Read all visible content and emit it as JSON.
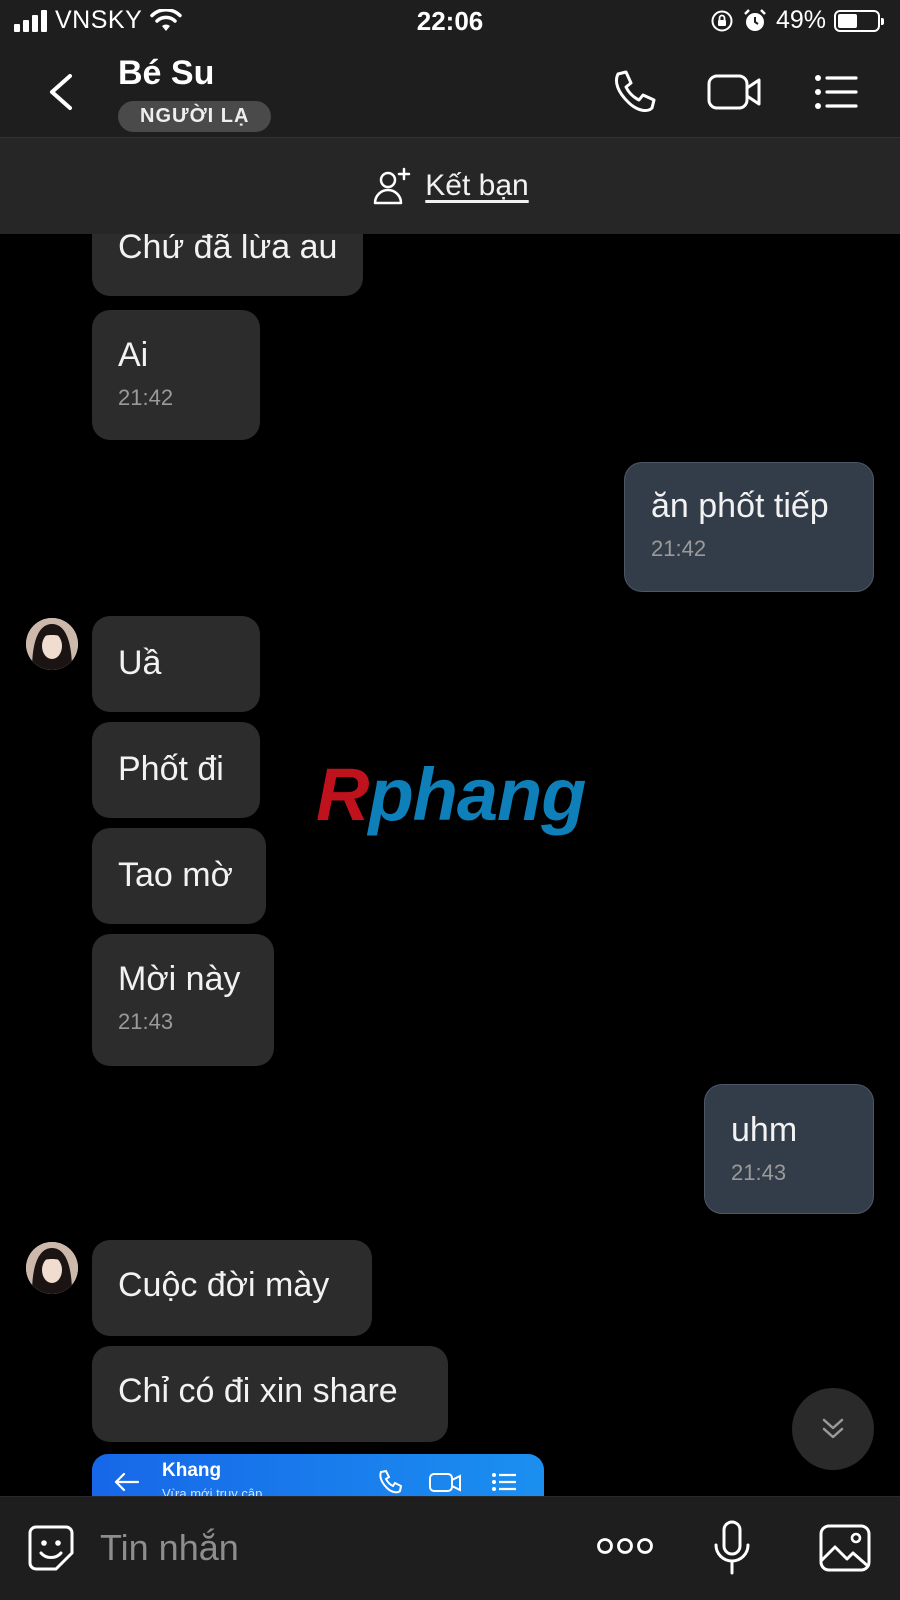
{
  "status_bar": {
    "carrier": "VNSKY",
    "time": "22:06",
    "battery_percent": "49%",
    "battery_level": 0.49
  },
  "header": {
    "contact_name": "Bé Su",
    "badge": "NGƯỜI LẠ",
    "icons": [
      "back-icon",
      "phone-icon",
      "video-camera-icon",
      "list-menu-icon"
    ]
  },
  "friend_bar": {
    "label": "Kết bạn",
    "icon": "add-user-icon"
  },
  "messages": [
    {
      "direction": "in",
      "text": "Chứ đã lừa au"
    },
    {
      "direction": "in",
      "text": "Ai",
      "time": "21:42"
    },
    {
      "direction": "out",
      "text": "ăn phốt tiếp",
      "time": "21:42"
    },
    {
      "direction": "in",
      "text": "Uầ",
      "avatar": true
    },
    {
      "direction": "in",
      "text": "Phốt đi"
    },
    {
      "direction": "in",
      "text": "Tao mờ"
    },
    {
      "direction": "in",
      "text": "Mời này",
      "time": "21:43"
    },
    {
      "direction": "out",
      "text": "uhm",
      "time": "21:43"
    },
    {
      "direction": "in",
      "text": "Cuộc đời mày",
      "avatar": true
    },
    {
      "direction": "in",
      "text": "Chỉ có đi xin share"
    }
  ],
  "shared_screenshot": {
    "name": "Khang",
    "subtitle": "Vừa mới truy cập"
  },
  "watermark": {
    "first_letter": "R",
    "rest": "phang"
  },
  "input_bar": {
    "placeholder": "Tin nhắn",
    "icons": [
      "sticker-icon",
      "more-icon",
      "microphone-icon",
      "gallery-icon"
    ]
  },
  "colors": {
    "background": "#000000",
    "bubble_in": "#2c2c2c",
    "bubble_out": "#333d4a",
    "header": "#1e1e1e"
  }
}
